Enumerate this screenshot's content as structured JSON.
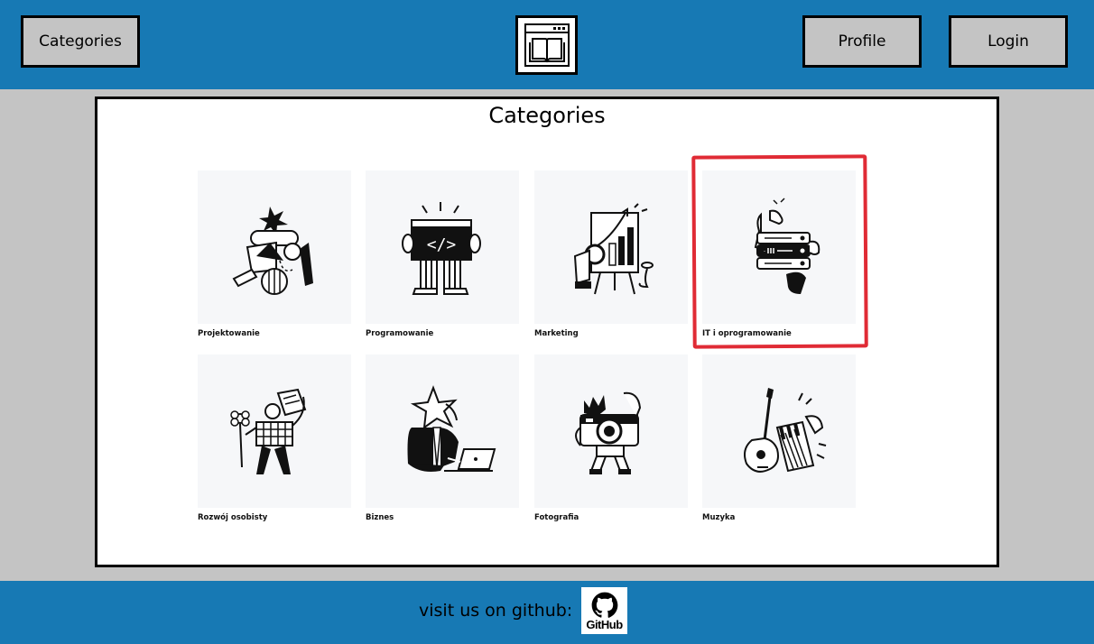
{
  "header": {
    "categories_label": "Categories",
    "profile_label": "Profile",
    "login_label": "Login",
    "logo_icon": "book-browser-icon"
  },
  "main": {
    "title": "Categories",
    "categories": [
      {
        "label": "Projektowanie",
        "icon": "design-illustration"
      },
      {
        "label": "Programowanie",
        "icon": "code-illustration"
      },
      {
        "label": "Marketing",
        "icon": "chart-illustration"
      },
      {
        "label": "IT i oprogramowanie",
        "icon": "server-illustration"
      },
      {
        "label": "Rozwój osobisty",
        "icon": "flower-person-illustration"
      },
      {
        "label": "Biznes",
        "icon": "laptop-person-illustration"
      },
      {
        "label": "Fotografia",
        "icon": "camera-illustration"
      },
      {
        "label": "Muzyka",
        "icon": "instruments-illustration"
      }
    ],
    "highlight_color": "#e02b35"
  },
  "footer": {
    "text": "visit us on github:",
    "github_label": "GitHub"
  },
  "colors": {
    "header_bg": "#1779b4",
    "page_bg": "#c4c4c4",
    "button_bg": "#c4c4c4"
  }
}
